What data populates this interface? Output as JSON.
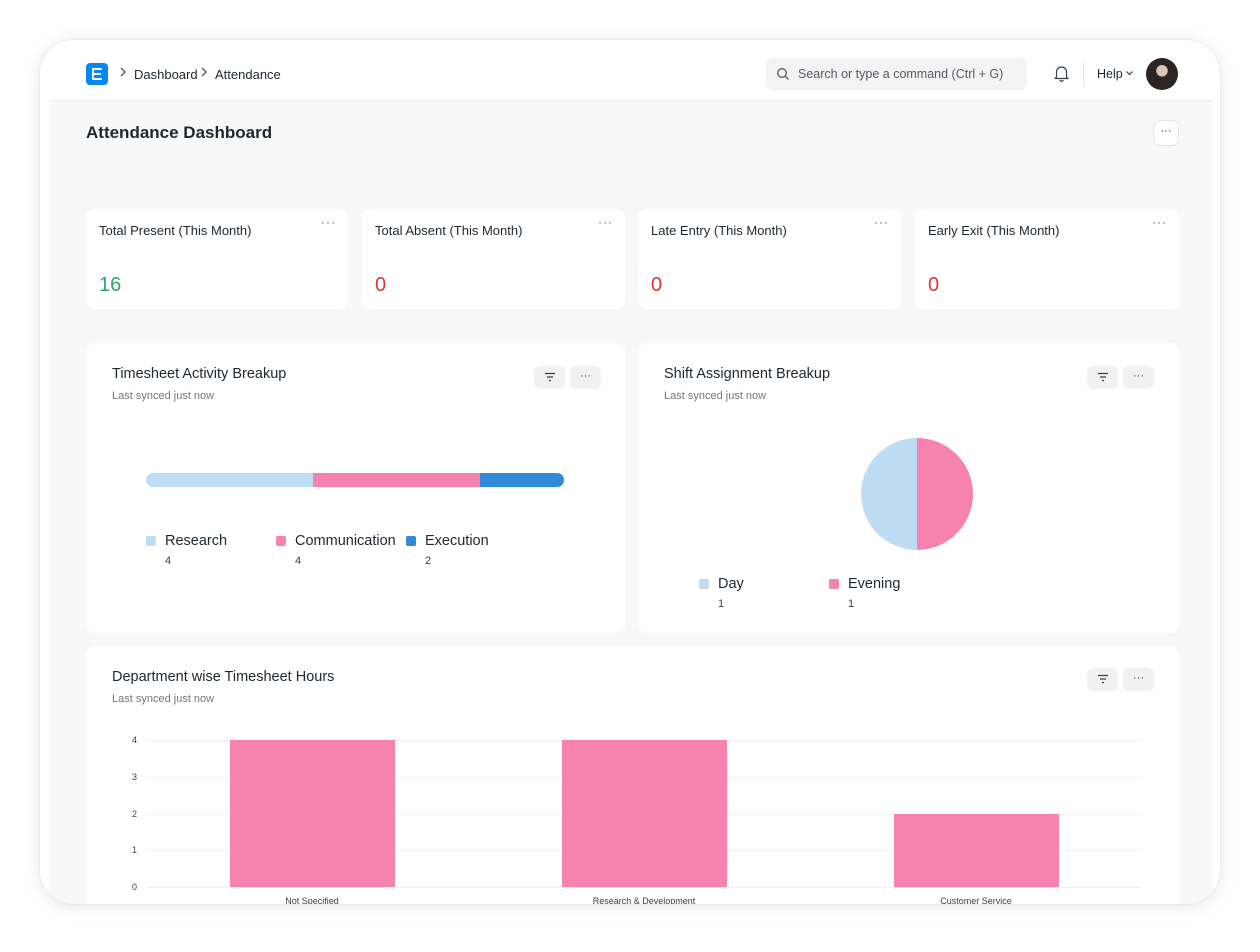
{
  "nav": {
    "breadcrumbs": [
      "Dashboard",
      "Attendance"
    ],
    "search_placeholder": "Search or type a command (Ctrl + G)",
    "help_label": "Help"
  },
  "page": {
    "title": "Attendance Dashboard",
    "menu_label": "···"
  },
  "number_cards": [
    {
      "title": "Total Present (This Month)",
      "value": "16",
      "color": "#30a66d"
    },
    {
      "title": "Total Absent (This Month)",
      "value": "0",
      "color": "#e03636"
    },
    {
      "title": "Late Entry (This Month)",
      "value": "0",
      "color": "#e03636"
    },
    {
      "title": "Early Exit (This Month)",
      "value": "0",
      "color": "#e03636"
    }
  ],
  "card_menu_label": "···",
  "colors": {
    "light_blue": "#bfdcf5",
    "pink": "#f683ae",
    "blue": "#318ad8"
  },
  "charts": {
    "timesheet": {
      "title": "Timesheet Activity Breakup",
      "subtitle": "Last synced just now",
      "legend": [
        {
          "label": "Research",
          "value": "4"
        },
        {
          "label": "Communication",
          "value": "4"
        },
        {
          "label": "Execution",
          "value": "2"
        }
      ]
    },
    "shift": {
      "title": "Shift Assignment Breakup",
      "subtitle": "Last synced just now",
      "legend": [
        {
          "label": "Day",
          "value": "1"
        },
        {
          "label": "Evening",
          "value": "1"
        }
      ]
    },
    "department": {
      "title": "Department wise Timesheet Hours",
      "subtitle": "Last synced just now",
      "yticks": [
        "0",
        "1",
        "2",
        "3",
        "4"
      ]
    }
  },
  "chart_data": [
    {
      "type": "bar",
      "title": "Timesheet Activity Breakup",
      "categories": [
        "Research",
        "Communication",
        "Execution"
      ],
      "values": [
        4,
        4,
        2
      ],
      "stacked_percentage": true
    },
    {
      "type": "pie",
      "title": "Shift Assignment Breakup",
      "categories": [
        "Day",
        "Evening"
      ],
      "values": [
        1,
        1
      ]
    },
    {
      "type": "bar",
      "title": "Department wise Timesheet Hours",
      "categories": [
        "Not Specified",
        "Research & Development",
        "Customer Service"
      ],
      "values": [
        4,
        4,
        2
      ],
      "ylim": [
        0,
        4
      ],
      "grid": true
    }
  ]
}
